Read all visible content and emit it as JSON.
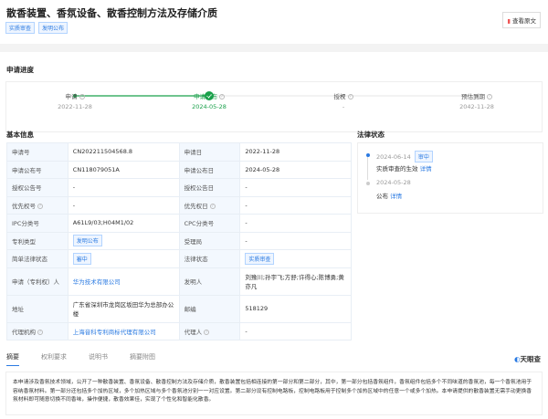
{
  "header": {
    "title": "散香装置、香氛设备、散香控制方法及存储介质",
    "tags": [
      "实质审查",
      "发明公布"
    ],
    "view_original": "查看原文"
  },
  "progress": {
    "title": "申请进度",
    "steps": [
      {
        "label": "申请",
        "date": "2022-11-28"
      },
      {
        "label": "申请公布",
        "date": "2024-05-28"
      },
      {
        "label": "授权",
        "date": "-"
      },
      {
        "label": "预估到期",
        "date": "2042-11-28"
      }
    ],
    "current_step": 2
  },
  "basic": {
    "title": "基本信息",
    "rows": [
      [
        "申请号",
        "CN202211504568.8",
        "申请日",
        "2022-11-28"
      ],
      [
        "申请公布号",
        "CN118079051A",
        "申请公布日",
        "2024-05-28"
      ],
      [
        "授权公告号",
        "-",
        "授权公告日",
        "-"
      ],
      [
        "优先权号",
        "-",
        "优先权日",
        "-"
      ],
      [
        "IPC分类号",
        "A61L9/03;H04M1/02",
        "CPC分类号",
        "-"
      ],
      [
        "专利类型",
        "发明公布",
        "受理局",
        "-"
      ],
      [
        "简单法律状态",
        "審中",
        "法律状态",
        "实质审查"
      ],
      [
        "申请（专利权）人",
        "华为技术有限公司",
        "发明人",
        "刘豫川;孙宇飞;方舒;许得心;陈博勇;黄亦凡"
      ],
      [
        "地址",
        "广东省深圳市龙岗区坂田华为总部办公楼",
        "邮编",
        "518129"
      ],
      [
        "代理机构",
        "上海音科专利商标代理有限公司",
        "代理人",
        "-"
      ]
    ]
  },
  "legal": {
    "title": "法律状态",
    "events": [
      {
        "date": "2024-06-14",
        "badge": "审中",
        "text": "实质审查的生效",
        "link": "详情"
      },
      {
        "date": "2024-05-28",
        "text": "公布",
        "link": "详情"
      }
    ]
  },
  "tabs": [
    "摘要",
    "权利要求",
    "说明书",
    "摘要附图"
  ],
  "brand": "天眼查",
  "abstract": "本申请涉及香氛技术领域，公开了一种散香装置、香氛设备、散香控制方法及存储介质，散香装置包括相连接的第一部分和第二部分，其中，第一部分包括香氛组件，香氛组件包括多个不同味道的香氛池，每一个香氛池用于容纳香氛材料。第一部分还包括多个加热区域，多个加热区域与多个香氛池分别一一对应设置。第二部分设有控制电路板，控制电路板用于控制多个加热区域中的任意一个或多个加热。本申请提供的散香装置无需手动更换香氛材料即可随意切换不同香味，操作便捷，散香效果佳，实现了个性化和智能化散香。",
  "colors": {
    "accent": "#2a7ae2",
    "success": "#19a04a"
  }
}
